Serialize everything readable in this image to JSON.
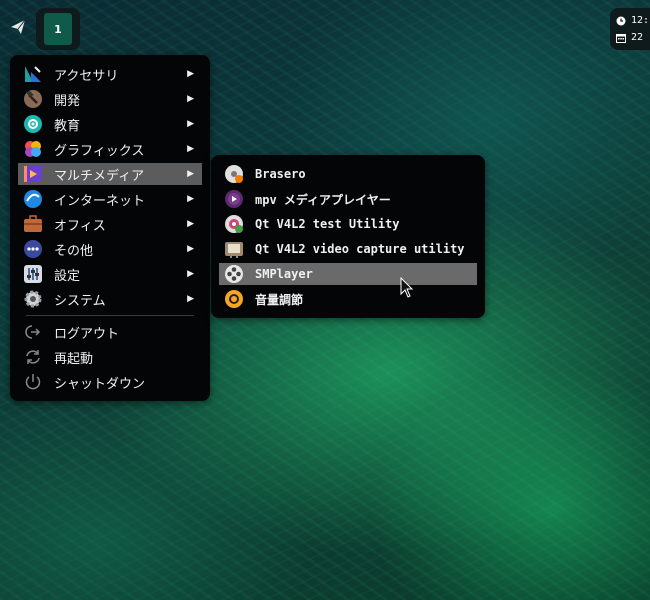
{
  "panel": {
    "workspace_label": "1",
    "clock_time": "12:",
    "clock_date": "22"
  },
  "main_menu": {
    "items": [
      {
        "label": "アクセサリ",
        "icon": "accessories-icon"
      },
      {
        "label": "開発",
        "icon": "hammer-icon"
      },
      {
        "label": "教育",
        "icon": "education-icon"
      },
      {
        "label": "グラフィックス",
        "icon": "graphics-icon"
      },
      {
        "label": "マルチメディア",
        "icon": "multimedia-icon"
      },
      {
        "label": "インターネット",
        "icon": "internet-icon"
      },
      {
        "label": "オフィス",
        "icon": "briefcase-icon"
      },
      {
        "label": "その他",
        "icon": "more-icon"
      },
      {
        "label": "設定",
        "icon": "settings-icon"
      },
      {
        "label": "システム",
        "icon": "system-gear-icon"
      }
    ],
    "session": [
      {
        "label": "ログアウト",
        "icon": "logout-icon"
      },
      {
        "label": "再起動",
        "icon": "reboot-icon"
      },
      {
        "label": "シャットダウン",
        "icon": "power-icon"
      }
    ],
    "highlighted_index": 4
  },
  "sub_menu": {
    "items": [
      {
        "label": "Brasero",
        "icon": "brasero-icon"
      },
      {
        "label": "mpv メディアプレイヤー",
        "icon": "mpv-icon"
      },
      {
        "label": "Qt V4L2 test Utility",
        "icon": "qv4l2-icon"
      },
      {
        "label": "Qt V4L2 video capture utility",
        "icon": "tv-icon"
      },
      {
        "label": "SMPlayer",
        "icon": "smplayer-icon"
      },
      {
        "label": "音量調節",
        "icon": "volume-icon"
      }
    ],
    "highlighted_index": 4
  },
  "colors": {
    "menu_bg": "#030506",
    "highlight": "#5c5c5c",
    "workspace_accent": "#0f5a48"
  }
}
